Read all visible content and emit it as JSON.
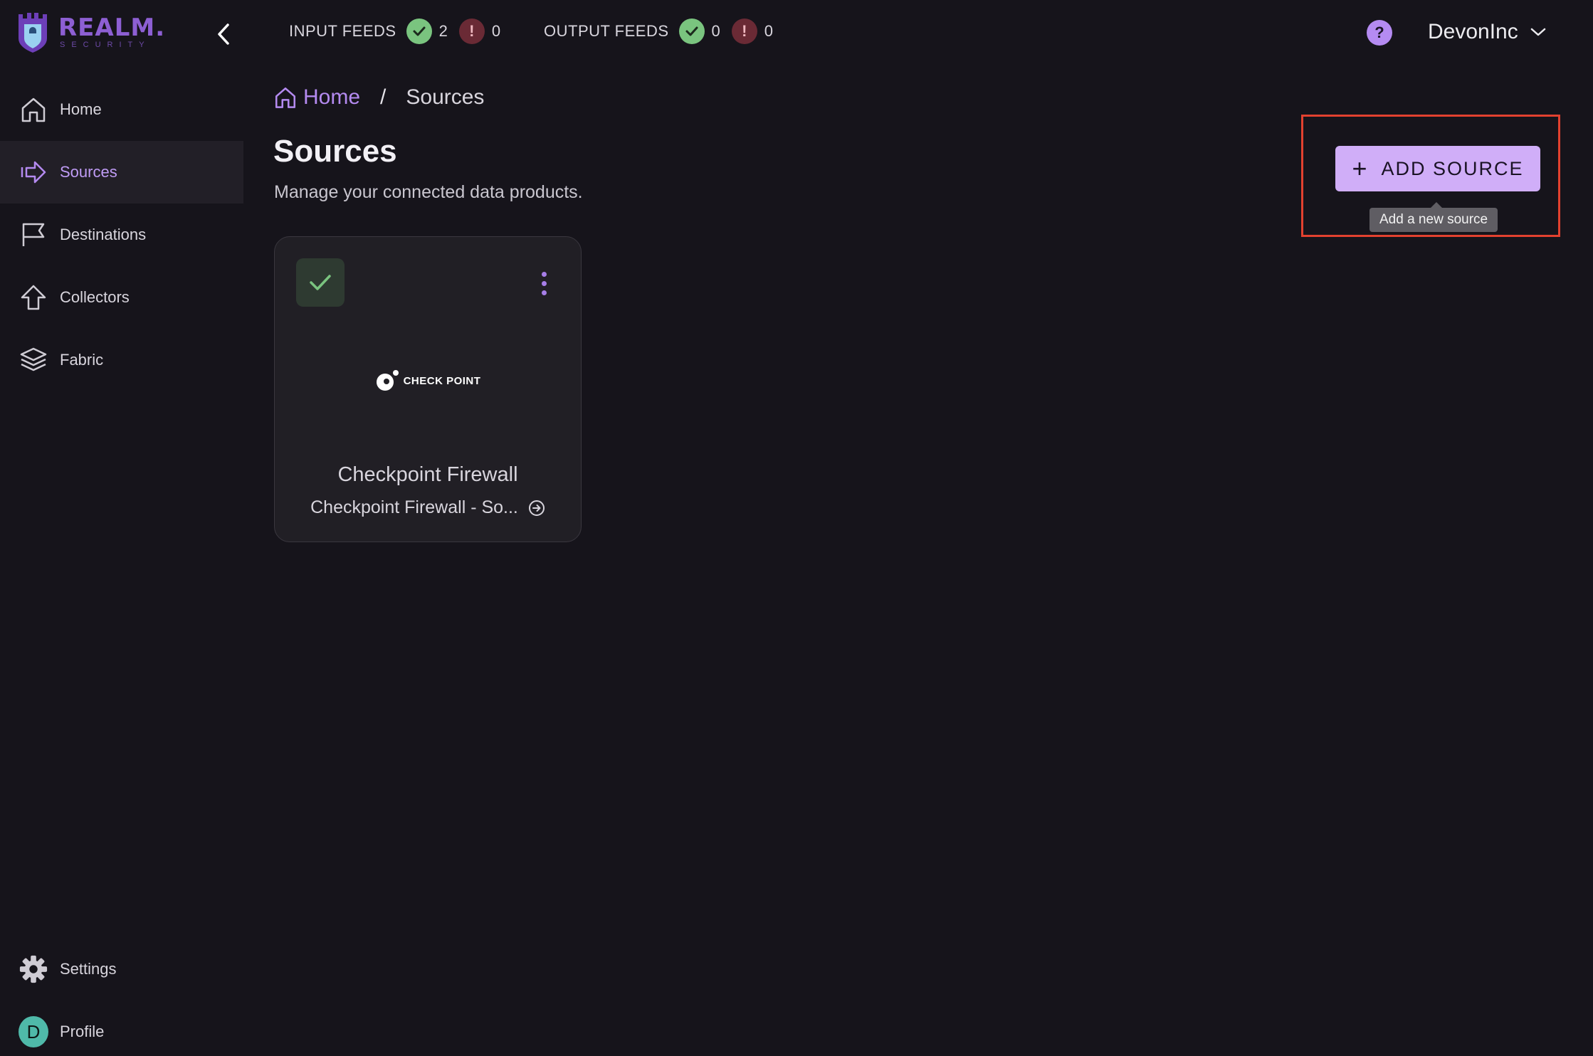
{
  "brand": {
    "name": "REALM.",
    "tagline": "SECURITY",
    "accent": "#8d5fd3"
  },
  "topbar": {
    "input_feeds": {
      "label": "INPUT FEEDS",
      "ok_count": "2",
      "error_count": "0"
    },
    "output_feeds": {
      "label": "OUTPUT FEEDS",
      "ok_count": "0",
      "error_count": "0"
    },
    "help_icon": "?",
    "org_name": "DevonInc"
  },
  "sidebar": {
    "items": [
      {
        "label": "Home",
        "icon": "home-icon"
      },
      {
        "label": "Sources",
        "icon": "sources-icon",
        "active": true
      },
      {
        "label": "Destinations",
        "icon": "flag-icon"
      },
      {
        "label": "Collectors",
        "icon": "upload-arrow-icon"
      },
      {
        "label": "Fabric",
        "icon": "layers-icon"
      }
    ],
    "bottom": [
      {
        "label": "Settings",
        "icon": "gear-icon"
      },
      {
        "label": "Profile",
        "avatar_letter": "D"
      }
    ]
  },
  "breadcrumb": {
    "home": "Home",
    "separator": "/",
    "current": "Sources"
  },
  "page": {
    "title": "Sources",
    "subtitle": "Manage your connected data products."
  },
  "actions": {
    "add_source_label": "ADD SOURCE",
    "add_source_tooltip": "Add a new source"
  },
  "sources": [
    {
      "vendor_logo_text": "CHECK POINT",
      "title": "Checkpoint Firewall",
      "subtitle": "Checkpoint Firewall - So...",
      "status": "ok"
    }
  ],
  "colors": {
    "background": "#16141b",
    "accent_purple": "#b48af0",
    "button_bg": "#d0aef8",
    "ok_green": "#7ac47f",
    "error_red": "#6a2a35",
    "highlight_box": "#e2412f"
  }
}
